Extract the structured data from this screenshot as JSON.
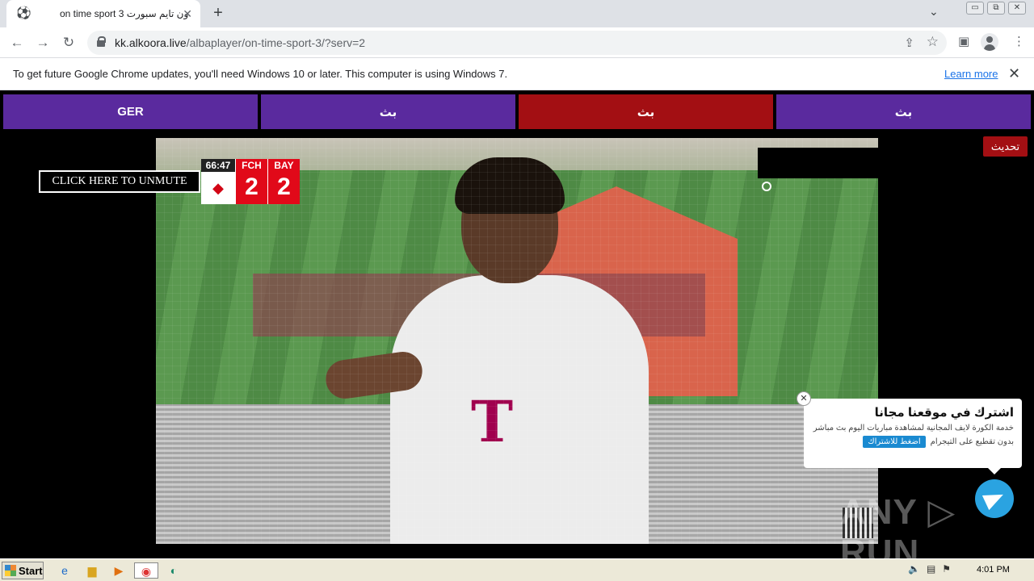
{
  "browser": {
    "tab": {
      "favicon": "soccer-ball-icon",
      "title": "on time sport 3 اون تايم سبورت",
      "close": "✕"
    },
    "new_tab": "+",
    "url_host": "kk.alkoora.live",
    "url_path": "/albaplayer/on-time-sport-3/?serv=2",
    "window_controls": [
      "▭",
      "⧉",
      "✕"
    ]
  },
  "infobar": {
    "message": "To get future Google Chrome updates, you'll need Windows 10 or later. This computer is using Windows 7.",
    "learn_more": "Learn more",
    "close": "✕"
  },
  "page": {
    "servers": [
      {
        "label": "GER",
        "active": false
      },
      {
        "label": "بث",
        "active": false
      },
      {
        "label": "بث",
        "active": true
      },
      {
        "label": "بث",
        "active": false
      }
    ],
    "refresh_label": "تحديث",
    "unmute_label": "CLICK HERE TO UNMUTE",
    "scoreboard": {
      "clock": "66:47",
      "home_abbr": "FCH",
      "home_score": "2",
      "away_abbr": "BAY",
      "away_score": "2"
    },
    "jersey_logo": "T",
    "popup": {
      "title": "اشترك في موقعنا مجانا",
      "desc": "خدمة الكورة لايف المجانية لمشاهدة مباريات اليوم بث مباشر",
      "line2": "بدون تقطيع على التيجرام",
      "cta": "اضغط للاشتراك",
      "close": "✕"
    },
    "watermark": "ANY ▷ RUN"
  },
  "taskbar": {
    "start_label": "Start",
    "clock": "4:01 PM"
  },
  "colors": {
    "server_purple": "#5a2a9e",
    "server_red": "#a30f13",
    "telegram_blue": "#2aa3e1"
  }
}
